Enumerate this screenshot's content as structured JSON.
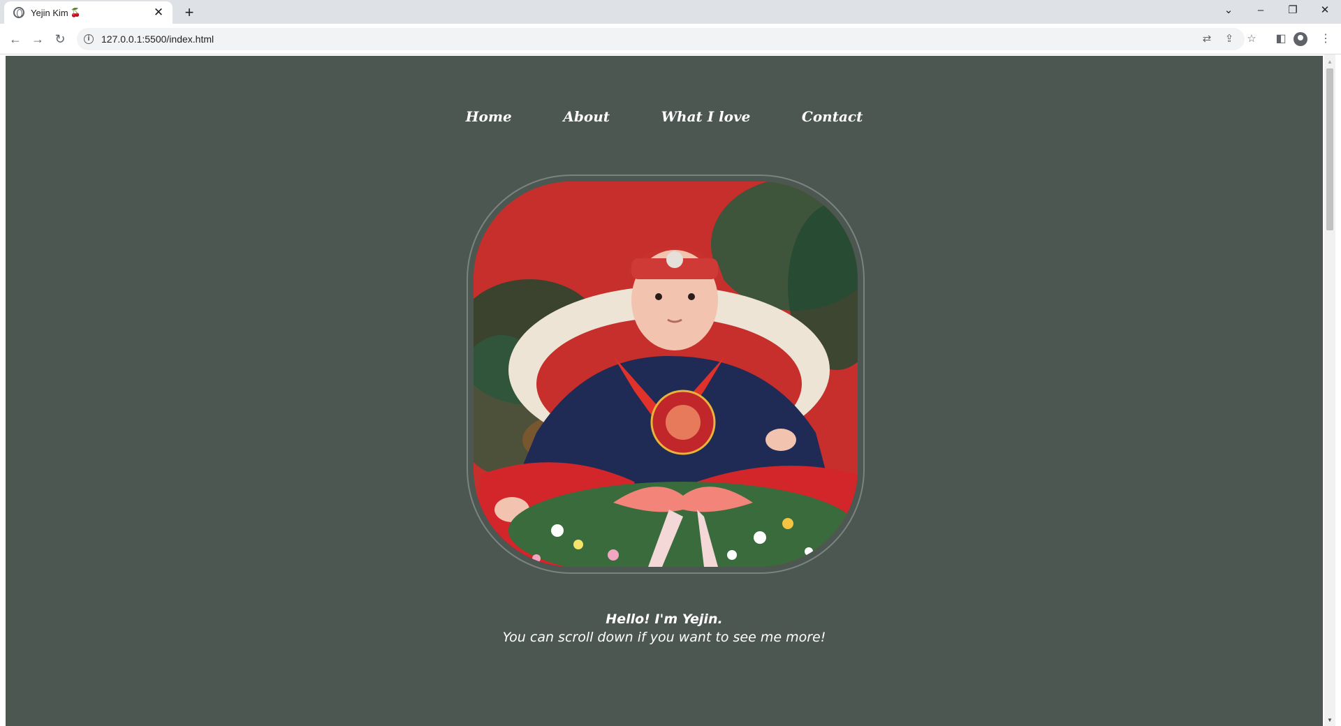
{
  "browser": {
    "tab_title": "Yejin Kim",
    "tab_emoji": "🍒",
    "url": "127.0.0.1:5500/index.html",
    "icons": {
      "favicon": "globe-icon",
      "tab_close": "close-icon",
      "new_tab": "plus-icon",
      "back": "arrow-left-icon",
      "forward": "arrow-right-icon",
      "reload": "reload-icon",
      "site_info": "info-icon",
      "translate": "translate-icon",
      "share": "share-icon",
      "bookmark": "star-icon",
      "side_panel": "side-panel-icon",
      "profile": "profile-icon",
      "menu": "kebab-menu-icon",
      "tab_search": "chevron-down-icon",
      "minimize": "minimize-icon",
      "restore": "restore-icon",
      "close_window": "close-window-icon"
    }
  },
  "site": {
    "nav": [
      {
        "label": "Home"
      },
      {
        "label": "About"
      },
      {
        "label": "What I love"
      },
      {
        "label": "Contact"
      }
    ],
    "hero_image": "baby-portrait-image",
    "greeting": "Hello! I'm Yejin.",
    "subtitle": "You can scroll down if you want to see me more!"
  },
  "colors": {
    "page_background": "#4c5752",
    "text": "#ffffff",
    "frame_border": "#7a837f",
    "photo_background": "#c42d2b"
  }
}
